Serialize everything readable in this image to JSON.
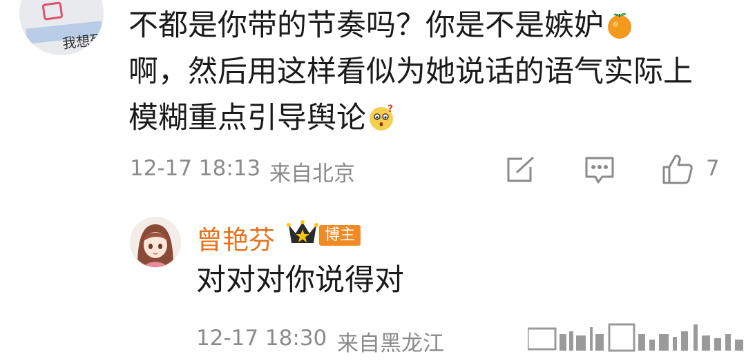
{
  "comment": {
    "avatar_caption": "我想死",
    "text_line1": "不都是你带的节奏吗？你是不是嫉妒",
    "text_line2": "啊，然后用这样看似为她说话的语气实际上",
    "text_line3": "模糊重点引导舆论",
    "emoji_1": "orange-emoji",
    "emoji_2": "confused-face-emoji",
    "timestamp": "12-17 18:13",
    "location": "来自北京",
    "like_count": "7"
  },
  "reply": {
    "author": "曾艳芬",
    "badge": "博主",
    "text": "对对对你说得对",
    "timestamp": "12-17 18:30",
    "location": "来自黑龙江"
  },
  "colors": {
    "author_orange": "#e8731e",
    "badge_orange": "#f08a24",
    "meta_gray": "#8a8a8a"
  }
}
